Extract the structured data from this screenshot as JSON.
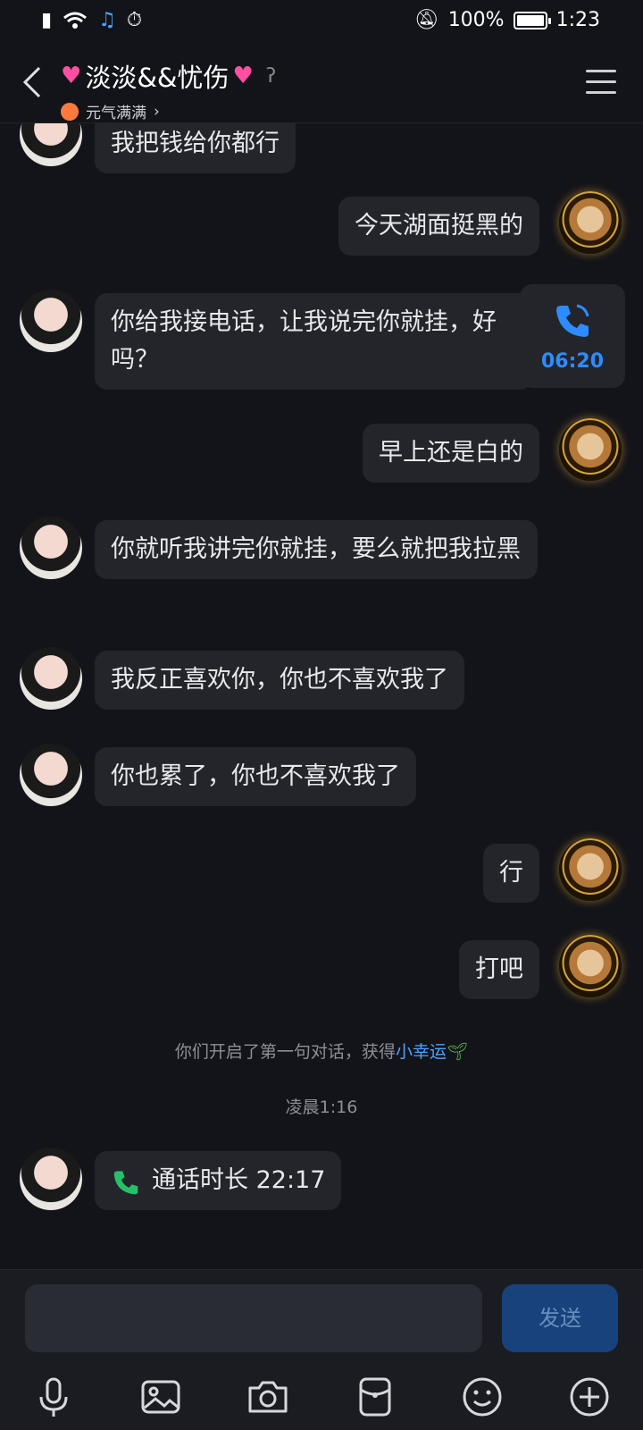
{
  "status": {
    "battery": "100%",
    "battery_level": 1.0,
    "time": "1:23"
  },
  "header": {
    "name": "淡淡&&忧伤",
    "status": "元气满满"
  },
  "messages": [
    {
      "side": "left",
      "text": "我把钱给你都行"
    },
    {
      "side": "right",
      "text": "今天湖面挺黑的"
    },
    {
      "side": "left",
      "text": "你给我接电话，让我说完你就挂，好吗？"
    },
    {
      "side": "right",
      "text": "早上还是白的"
    },
    {
      "side": "left",
      "text": "你就听我讲完你就挂，要么就把我拉黑"
    },
    {
      "side": "left",
      "text": "我反正喜欢你，你也不喜欢我了"
    },
    {
      "side": "left",
      "text": "你也累了，你也不喜欢我了"
    },
    {
      "side": "right",
      "text": "行"
    },
    {
      "side": "right",
      "text": "打吧"
    }
  ],
  "call_card": {
    "duration": "06:20"
  },
  "system_notice": {
    "prefix": "你们开启了第一句对话，获得",
    "highlight": "小幸运"
  },
  "timestamp": "凌晨1:16",
  "call_record": {
    "label": "通话时长 22:17"
  },
  "input": {
    "placeholder": "",
    "send_label": "发送"
  },
  "colors": {
    "accent": "#2d8cff",
    "call_green": "#27c06a",
    "heart": "#ff4fa0"
  }
}
